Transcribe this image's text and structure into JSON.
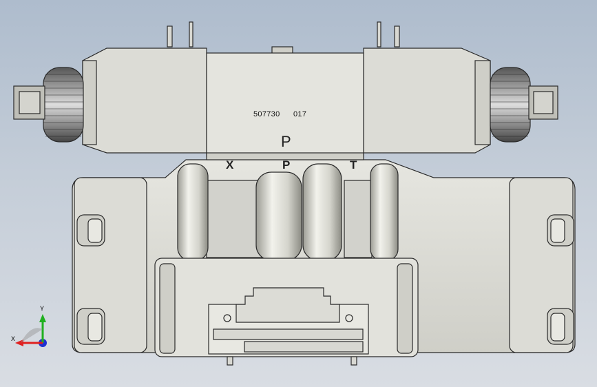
{
  "model": {
    "part_number": "507730",
    "revision": "017",
    "pilot_port_label": "P",
    "ports": [
      "X",
      "P",
      "T"
    ]
  },
  "triad": {
    "x_label": "X",
    "y_label": "Y",
    "x_color": "#e02020",
    "y_color": "#20b020",
    "z_color": "#2030d0"
  },
  "colors": {
    "background_top": "#aebccd",
    "part_body": "#d8d8d2",
    "outline": "#2a2a2a"
  }
}
